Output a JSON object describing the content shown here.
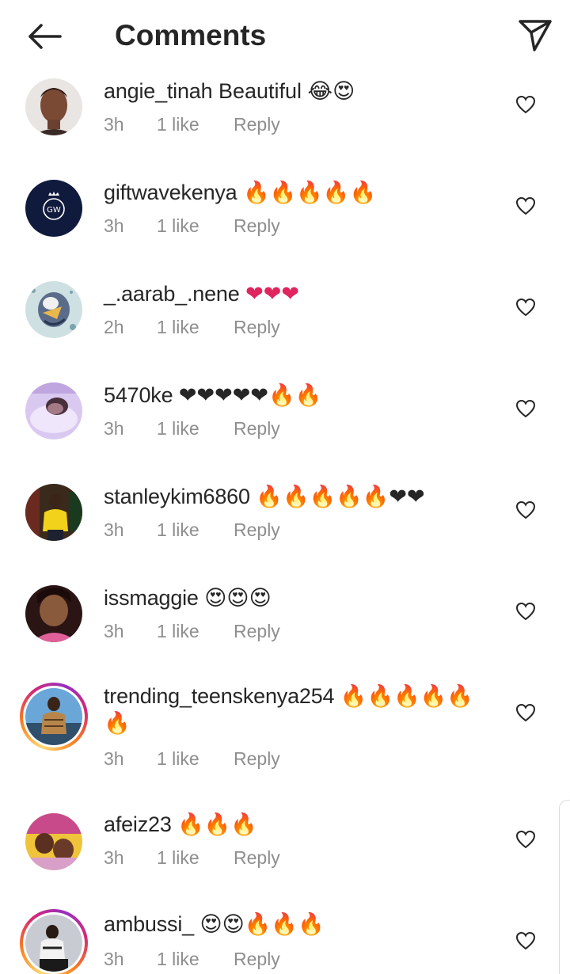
{
  "header": {
    "title": "Comments"
  },
  "comments": [
    {
      "username": "angie_tinah",
      "text": "Beautiful 😂😍",
      "time": "3h",
      "likes": "1 like",
      "reply": "Reply"
    },
    {
      "username": "giftwavekenya",
      "text": "🔥🔥🔥🔥🔥",
      "time": "3h",
      "likes": "1 like",
      "reply": "Reply"
    },
    {
      "username": "_.aarab_.nene",
      "text": "❤❤❤",
      "time": "2h",
      "likes": "1 like",
      "reply": "Reply"
    },
    {
      "username": "5470ke",
      "text": "❤❤❤❤❤🔥🔥",
      "time": "3h",
      "likes": "1 like",
      "reply": "Reply"
    },
    {
      "username": "stanleykim6860",
      "text": "🔥🔥🔥🔥🔥❤❤",
      "time": "3h",
      "likes": "1 like",
      "reply": "Reply"
    },
    {
      "username": "issmaggie",
      "text": "😍😍😍",
      "time": "3h",
      "likes": "1 like",
      "reply": "Reply"
    },
    {
      "username": "trending_teenskenya254",
      "text": "🔥🔥🔥🔥🔥🔥",
      "time": "3h",
      "likes": "1 like",
      "reply": "Reply"
    },
    {
      "username": "afeiz23",
      "text": "🔥🔥🔥",
      "time": "3h",
      "likes": "1 like",
      "reply": "Reply"
    },
    {
      "username": "ambussi_",
      "text": "😍😍🔥🔥🔥",
      "time": "3h",
      "likes": "1 like",
      "reply": "Reply"
    }
  ],
  "avatars": {
    "1": {
      "monogram": "GW"
    }
  },
  "icons": {
    "back": "arrow-left-icon",
    "share": "paper-plane-icon",
    "like": "heart-outline-icon"
  },
  "colors": {
    "text_primary": "#262626",
    "text_secondary": "#8e8e8e",
    "story_ring": "#d62976"
  }
}
